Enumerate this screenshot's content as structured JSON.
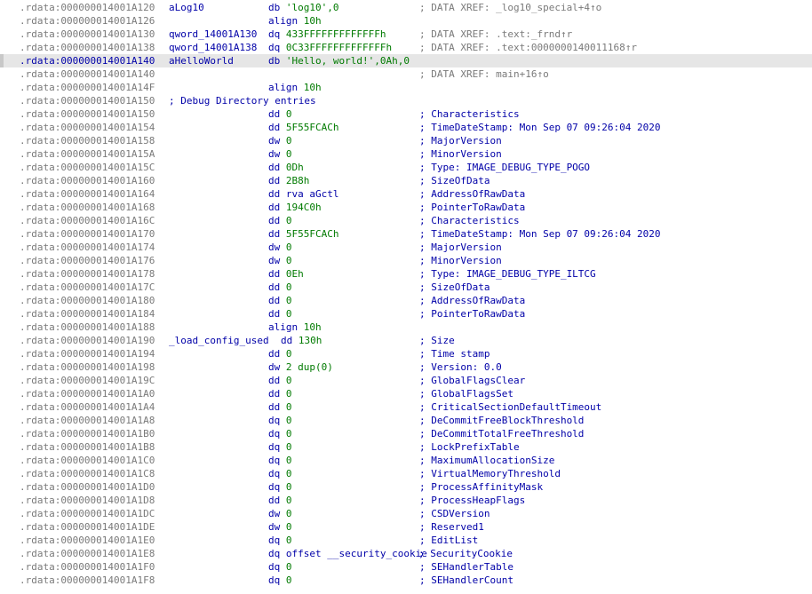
{
  "colors": {
    "address": "#7a7a7a",
    "label": "#0000a8",
    "mnemonic": "#0000a8",
    "operand_number": "#007a00",
    "comment": "#0000a8",
    "xref_comment": "#7a7a7a",
    "selected_row": "#e6e6e6"
  },
  "lines": [
    {
      "addr": ".rdata:000000014001A120",
      "label": "aLog10",
      "op": "db",
      "arg": "'log10',0",
      "comment": "; DATA XREF: _log10_special+4↑o",
      "xref": true
    },
    {
      "addr": ".rdata:000000014001A126",
      "label": "",
      "op": "align",
      "arg": "10h",
      "comment": ""
    },
    {
      "addr": ".rdata:000000014001A130",
      "label": "qword_14001A130",
      "op": "dq",
      "arg": "433FFFFFFFFFFFFFh",
      "comment": "; DATA XREF: .text:_frnd↑r",
      "xref": true
    },
    {
      "addr": ".rdata:000000014001A138",
      "label": "qword_14001A138",
      "op": "dq",
      "arg": "0C33FFFFFFFFFFFFFh",
      "comment": "; DATA XREF: .text:0000000140011168↑r",
      "xref": true
    },
    {
      "addr": ".rdata:000000014001A140",
      "label": "aHelloWorld",
      "op": "db",
      "arg": "'Hello, world!',0Ah,0",
      "comment": "",
      "selected": true
    },
    {
      "addr": ".rdata:000000014001A140",
      "label": "",
      "op": "",
      "arg": "",
      "comment": "; DATA XREF: main+16↑o",
      "xref": true
    },
    {
      "addr": ".rdata:000000014001A14F",
      "label": "",
      "op": "align",
      "arg": "10h",
      "comment": ""
    },
    {
      "addr": ".rdata:000000014001A150",
      "label": "; Debug Directory entries",
      "op": "",
      "arg": "",
      "comment": "",
      "section": true
    },
    {
      "addr": ".rdata:000000014001A150",
      "label": "",
      "op": "dd",
      "arg": "0",
      "comment": "; Characteristics"
    },
    {
      "addr": ".rdata:000000014001A154",
      "label": "",
      "op": "dd",
      "arg": "5F55FCACh",
      "comment": "; TimeDateStamp: Mon Sep 07 09:26:04 2020"
    },
    {
      "addr": ".rdata:000000014001A158",
      "label": "",
      "op": "dw",
      "arg": "0",
      "comment": "; MajorVersion"
    },
    {
      "addr": ".rdata:000000014001A15A",
      "label": "",
      "op": "dw",
      "arg": "0",
      "comment": "; MinorVersion"
    },
    {
      "addr": ".rdata:000000014001A15C",
      "label": "",
      "op": "dd",
      "arg": "0Dh",
      "comment": "; Type: IMAGE_DEBUG_TYPE_POGO"
    },
    {
      "addr": ".rdata:000000014001A160",
      "label": "",
      "op": "dd",
      "arg": "2B8h",
      "comment": "; SizeOfData"
    },
    {
      "addr": ".rdata:000000014001A164",
      "label": "",
      "op": "dd",
      "arg": "rva aGctl",
      "comment": "; AddressOfRawData"
    },
    {
      "addr": ".rdata:000000014001A168",
      "label": "",
      "op": "dd",
      "arg": "194C0h",
      "comment": "; PointerToRawData"
    },
    {
      "addr": ".rdata:000000014001A16C",
      "label": "",
      "op": "dd",
      "arg": "0",
      "comment": "; Characteristics"
    },
    {
      "addr": ".rdata:000000014001A170",
      "label": "",
      "op": "dd",
      "arg": "5F55FCACh",
      "comment": "; TimeDateStamp: Mon Sep 07 09:26:04 2020"
    },
    {
      "addr": ".rdata:000000014001A174",
      "label": "",
      "op": "dw",
      "arg": "0",
      "comment": "; MajorVersion"
    },
    {
      "addr": ".rdata:000000014001A176",
      "label": "",
      "op": "dw",
      "arg": "0",
      "comment": "; MinorVersion"
    },
    {
      "addr": ".rdata:000000014001A178",
      "label": "",
      "op": "dd",
      "arg": "0Eh",
      "comment": "; Type: IMAGE_DEBUG_TYPE_ILTCG"
    },
    {
      "addr": ".rdata:000000014001A17C",
      "label": "",
      "op": "dd",
      "arg": "0",
      "comment": "; SizeOfData"
    },
    {
      "addr": ".rdata:000000014001A180",
      "label": "",
      "op": "dd",
      "arg": "0",
      "comment": "; AddressOfRawData"
    },
    {
      "addr": ".rdata:000000014001A184",
      "label": "",
      "op": "dd",
      "arg": "0",
      "comment": "; PointerToRawData"
    },
    {
      "addr": ".rdata:000000014001A188",
      "label": "",
      "op": "align",
      "arg": "10h",
      "comment": ""
    },
    {
      "addr": ".rdata:000000014001A190",
      "label": "_load_config_used",
      "op": "dd",
      "arg": "130h",
      "comment": "; Size",
      "long_label": true
    },
    {
      "addr": ".rdata:000000014001A194",
      "label": "",
      "op": "dd",
      "arg": "0",
      "comment": "; Time stamp"
    },
    {
      "addr": ".rdata:000000014001A198",
      "label": "",
      "op": "dw",
      "arg": "2 dup(0)",
      "comment": "; Version: 0.0"
    },
    {
      "addr": ".rdata:000000014001A19C",
      "label": "",
      "op": "dd",
      "arg": "0",
      "comment": "; GlobalFlagsClear"
    },
    {
      "addr": ".rdata:000000014001A1A0",
      "label": "",
      "op": "dd",
      "arg": "0",
      "comment": "; GlobalFlagsSet"
    },
    {
      "addr": ".rdata:000000014001A1A4",
      "label": "",
      "op": "dd",
      "arg": "0",
      "comment": "; CriticalSectionDefaultTimeout"
    },
    {
      "addr": ".rdata:000000014001A1A8",
      "label": "",
      "op": "dq",
      "arg": "0",
      "comment": "; DeCommitFreeBlockThreshold"
    },
    {
      "addr": ".rdata:000000014001A1B0",
      "label": "",
      "op": "dq",
      "arg": "0",
      "comment": "; DeCommitTotalFreeThreshold"
    },
    {
      "addr": ".rdata:000000014001A1B8",
      "label": "",
      "op": "dq",
      "arg": "0",
      "comment": "; LockPrefixTable"
    },
    {
      "addr": ".rdata:000000014001A1C0",
      "label": "",
      "op": "dq",
      "arg": "0",
      "comment": "; MaximumAllocationSize"
    },
    {
      "addr": ".rdata:000000014001A1C8",
      "label": "",
      "op": "dq",
      "arg": "0",
      "comment": "; VirtualMemoryThreshold"
    },
    {
      "addr": ".rdata:000000014001A1D0",
      "label": "",
      "op": "dq",
      "arg": "0",
      "comment": "; ProcessAffinityMask"
    },
    {
      "addr": ".rdata:000000014001A1D8",
      "label": "",
      "op": "dd",
      "arg": "0",
      "comment": "; ProcessHeapFlags"
    },
    {
      "addr": ".rdata:000000014001A1DC",
      "label": "",
      "op": "dw",
      "arg": "0",
      "comment": "; CSDVersion"
    },
    {
      "addr": ".rdata:000000014001A1DE",
      "label": "",
      "op": "dw",
      "arg": "0",
      "comment": "; Reserved1"
    },
    {
      "addr": ".rdata:000000014001A1E0",
      "label": "",
      "op": "dq",
      "arg": "0",
      "comment": "; EditList"
    },
    {
      "addr": ".rdata:000000014001A1E8",
      "label": "",
      "op": "dq",
      "arg": "offset __security_cookie",
      "comment": "; SecurityCookie",
      "inline_comment": true
    },
    {
      "addr": ".rdata:000000014001A1F0",
      "label": "",
      "op": "dq",
      "arg": "0",
      "comment": "; SEHandlerTable"
    },
    {
      "addr": ".rdata:000000014001A1F8",
      "label": "",
      "op": "dq",
      "arg": "0",
      "comment": "; SEHandlerCount"
    }
  ]
}
